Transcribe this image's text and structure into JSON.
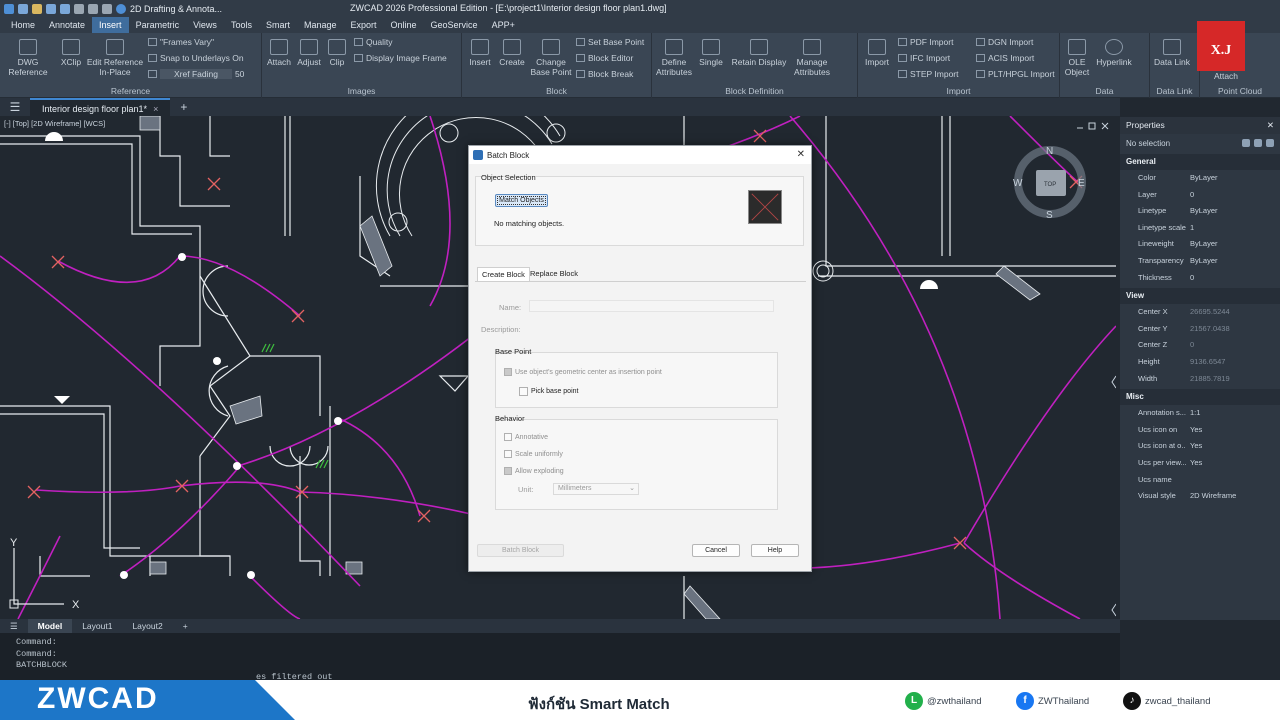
{
  "titlebar": {
    "workspace": "2D Drafting & Annota...",
    "title": "ZWCAD 2026 Professional Edition - [E:\\project1\\Interior design floor plan1.dwg]"
  },
  "menu": [
    "Home",
    "Annotate",
    "Insert",
    "Parametric",
    "Views",
    "Tools",
    "Smart",
    "Manage",
    "Export",
    "Online",
    "GeoService",
    "APP+"
  ],
  "menu_active": "Insert",
  "ribbon": {
    "reference": {
      "title": "Reference",
      "dwg": "DWG Reference",
      "xclip": "XClip",
      "edit_ref": "Edit Reference In-Place",
      "frames": "\"Frames Vary\"",
      "snap": "Snap to Underlays On",
      "xref_fading": "Xref Fading",
      "fading_value": "50"
    },
    "images": {
      "title": "Images",
      "attach": "Attach",
      "adjust": "Adjust",
      "clip": "Clip",
      "quality": "Quality",
      "display_frame": "Display Image Frame"
    },
    "block": {
      "title": "Block",
      "insert": "Insert",
      "create": "Create",
      "change_base": "Change Base Point",
      "set_base": "Set Base Point",
      "block_editor": "Block Editor",
      "block_break": "Block Break"
    },
    "block_def": {
      "title": "Block Definition",
      "define_attr": "Define Attributes",
      "single": "Single",
      "retain": "Retain Display",
      "manage_attr": "Manage Attributes"
    },
    "import": {
      "title": "Import",
      "import": "Import",
      "pdf": "PDF Import",
      "ifc": "IFC Import",
      "step": "STEP Import",
      "dgn": "DGN Import",
      "acis": "ACIS Import",
      "plt": "PLT/HPGL Import"
    },
    "data": {
      "title": "Data",
      "ole": "OLE Object",
      "hyperlink": "Hyperlink"
    },
    "data_link": {
      "title": "Data Link",
      "label": "Data Link"
    },
    "point_cloud": {
      "title": "Point Cloud",
      "attach": "Attach"
    }
  },
  "logo_text": "X.J",
  "doc_tab": "Interior design floor plan1*",
  "viewport_label": "[-] [Top] [2D Wireframe] [WCS]",
  "viewcube": {
    "n": "N",
    "s": "S",
    "e": "E",
    "w": "W",
    "top": "TOP"
  },
  "ucs": {
    "x": "X",
    "y": "Y"
  },
  "properties": {
    "title": "Properties",
    "selection": "No selection",
    "general_title": "General",
    "general": [
      {
        "k": "Color",
        "v": "ByLayer"
      },
      {
        "k": "Layer",
        "v": "0"
      },
      {
        "k": "Linetype",
        "v": "ByLayer"
      },
      {
        "k": "Linetype scale",
        "v": "1"
      },
      {
        "k": "Lineweight",
        "v": "ByLayer"
      },
      {
        "k": "Transparency",
        "v": "ByLayer"
      },
      {
        "k": "Thickness",
        "v": "0"
      }
    ],
    "view_title": "View",
    "view": [
      {
        "k": "Center X",
        "v": "26695.5244"
      },
      {
        "k": "Center Y",
        "v": "21567.0438"
      },
      {
        "k": "Center Z",
        "v": "0"
      },
      {
        "k": "Height",
        "v": "9136.6547"
      },
      {
        "k": "Width",
        "v": "21885.7819"
      }
    ],
    "misc_title": "Misc",
    "misc": [
      {
        "k": "Annotation s...",
        "v": "1:1"
      },
      {
        "k": "Ucs icon on",
        "v": "Yes"
      },
      {
        "k": "Ucs icon at o...",
        "v": "Yes"
      },
      {
        "k": "Ucs per view...",
        "v": "Yes"
      },
      {
        "k": "Ucs name",
        "v": ""
      },
      {
        "k": "Visual style",
        "v": "2D Wireframe"
      }
    ]
  },
  "layout_tabs": [
    "Model",
    "Layout1",
    "Layout2"
  ],
  "command_lines": [
    "Command:",
    "Command:",
    "BATCHBLOCK"
  ],
  "command_partial": "es filtered out",
  "dialog": {
    "title": "Batch Block",
    "object_selection": "Object Selection",
    "match_button": "Match Objects",
    "no_match": "No matching objects.",
    "tab_create": "Create Block",
    "tab_replace": "Replace Block",
    "name_label": "Name:",
    "description_label": "Description:",
    "base_point_title": "Base Point",
    "use_center": "Use object's geometric center as insertion point",
    "pick_base": "Pick base point",
    "behavior_title": "Behavior",
    "annotative": "Annotative",
    "scale_uniformly": "Scale uniformly",
    "allow_exploding": "Allow exploding",
    "unit_label": "Unit:",
    "unit_value": "Millimeters",
    "batch_block_btn": "Batch Block",
    "cancel_btn": "Cancel",
    "help_btn": "Help"
  },
  "footer": {
    "logo": "ZWCAD",
    "title": "ฟังก์ชัน Smart Match",
    "line": "@zwthailand",
    "facebook": "ZWThailand",
    "tiktok": "zwcad_thailand"
  }
}
